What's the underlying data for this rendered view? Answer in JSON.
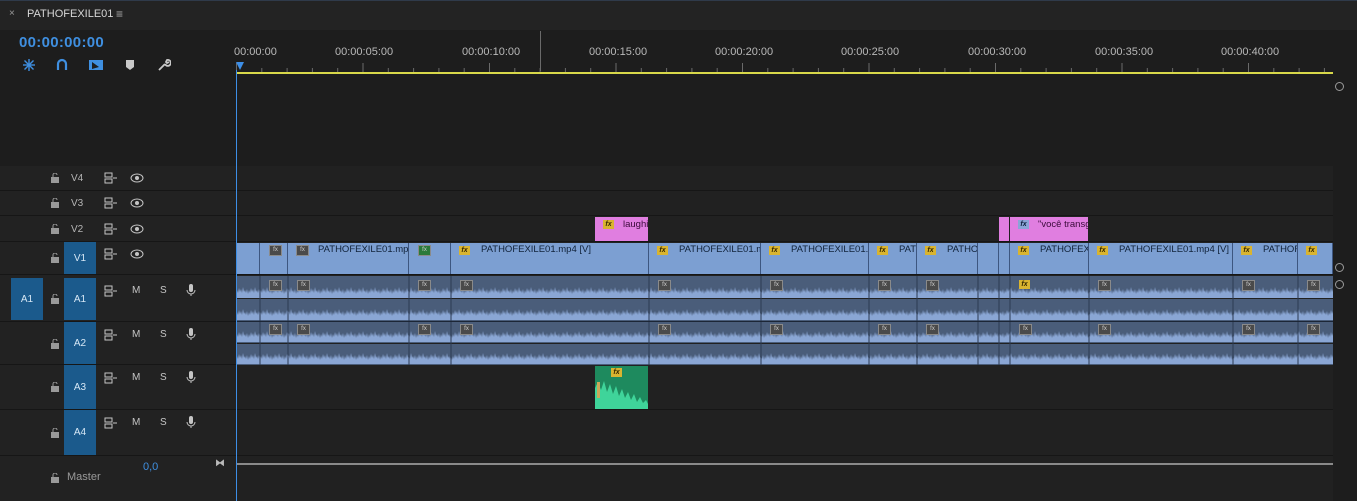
{
  "sequence": {
    "name": "PATHOFEXILE01",
    "close": "×",
    "menu": "≡"
  },
  "timecode": "00:00:00:00",
  "toolbar": {
    "tools": [
      "snap-icon",
      "linked-selection-icon",
      "add-marker-icon",
      "marker-icon",
      "wrench-icon"
    ]
  },
  "ruler": {
    "labels": [
      "00:00:00",
      "00:00:05:00",
      "00:00:10:00",
      "00:00:15:00",
      "00:00:20:00",
      "00:00:25:00",
      "00:00:30:00",
      "00:00:35:00",
      "00:00:40:00"
    ]
  },
  "tracks": {
    "video": [
      {
        "name": "V4",
        "target": false
      },
      {
        "name": "V3",
        "target": false
      },
      {
        "name": "V2",
        "target": false
      },
      {
        "name": "V1",
        "target": true
      }
    ],
    "audio": [
      {
        "name": "A1",
        "source": "A1",
        "m": "M",
        "s": "S"
      },
      {
        "name": "A2",
        "source": "",
        "m": "M",
        "s": "S"
      },
      {
        "name": "A3",
        "source": "",
        "m": "M",
        "s": "S"
      },
      {
        "name": "A4",
        "source": "",
        "m": "M",
        "s": "S"
      }
    ],
    "master": {
      "name": "Master",
      "value": "0,0"
    }
  },
  "clips": {
    "v1_labels": [
      "PATHOFEXILE01.mp4 [V]",
      "PATHOFEXILE01.mp4 [V]",
      "PATHOFEXILE01.mp4",
      "PATHOFEXILE01.mp",
      "PATH",
      "PATHO",
      "PATHOFEXILI",
      "PATHOFEXILE01.mp4 [V]",
      "PATHOF"
    ],
    "v2_labels": [
      "laughi",
      "\"você transg"
    ],
    "fx": "fx"
  },
  "colors": {
    "accent": "#3d8ee6",
    "video_clip": "#7c9fd2",
    "audio_clip": "#4a5d7a",
    "graphic_clip": "#e07ee0",
    "audio_green": "#1e8a5e",
    "ruler_work_area": "#d8d84a"
  }
}
